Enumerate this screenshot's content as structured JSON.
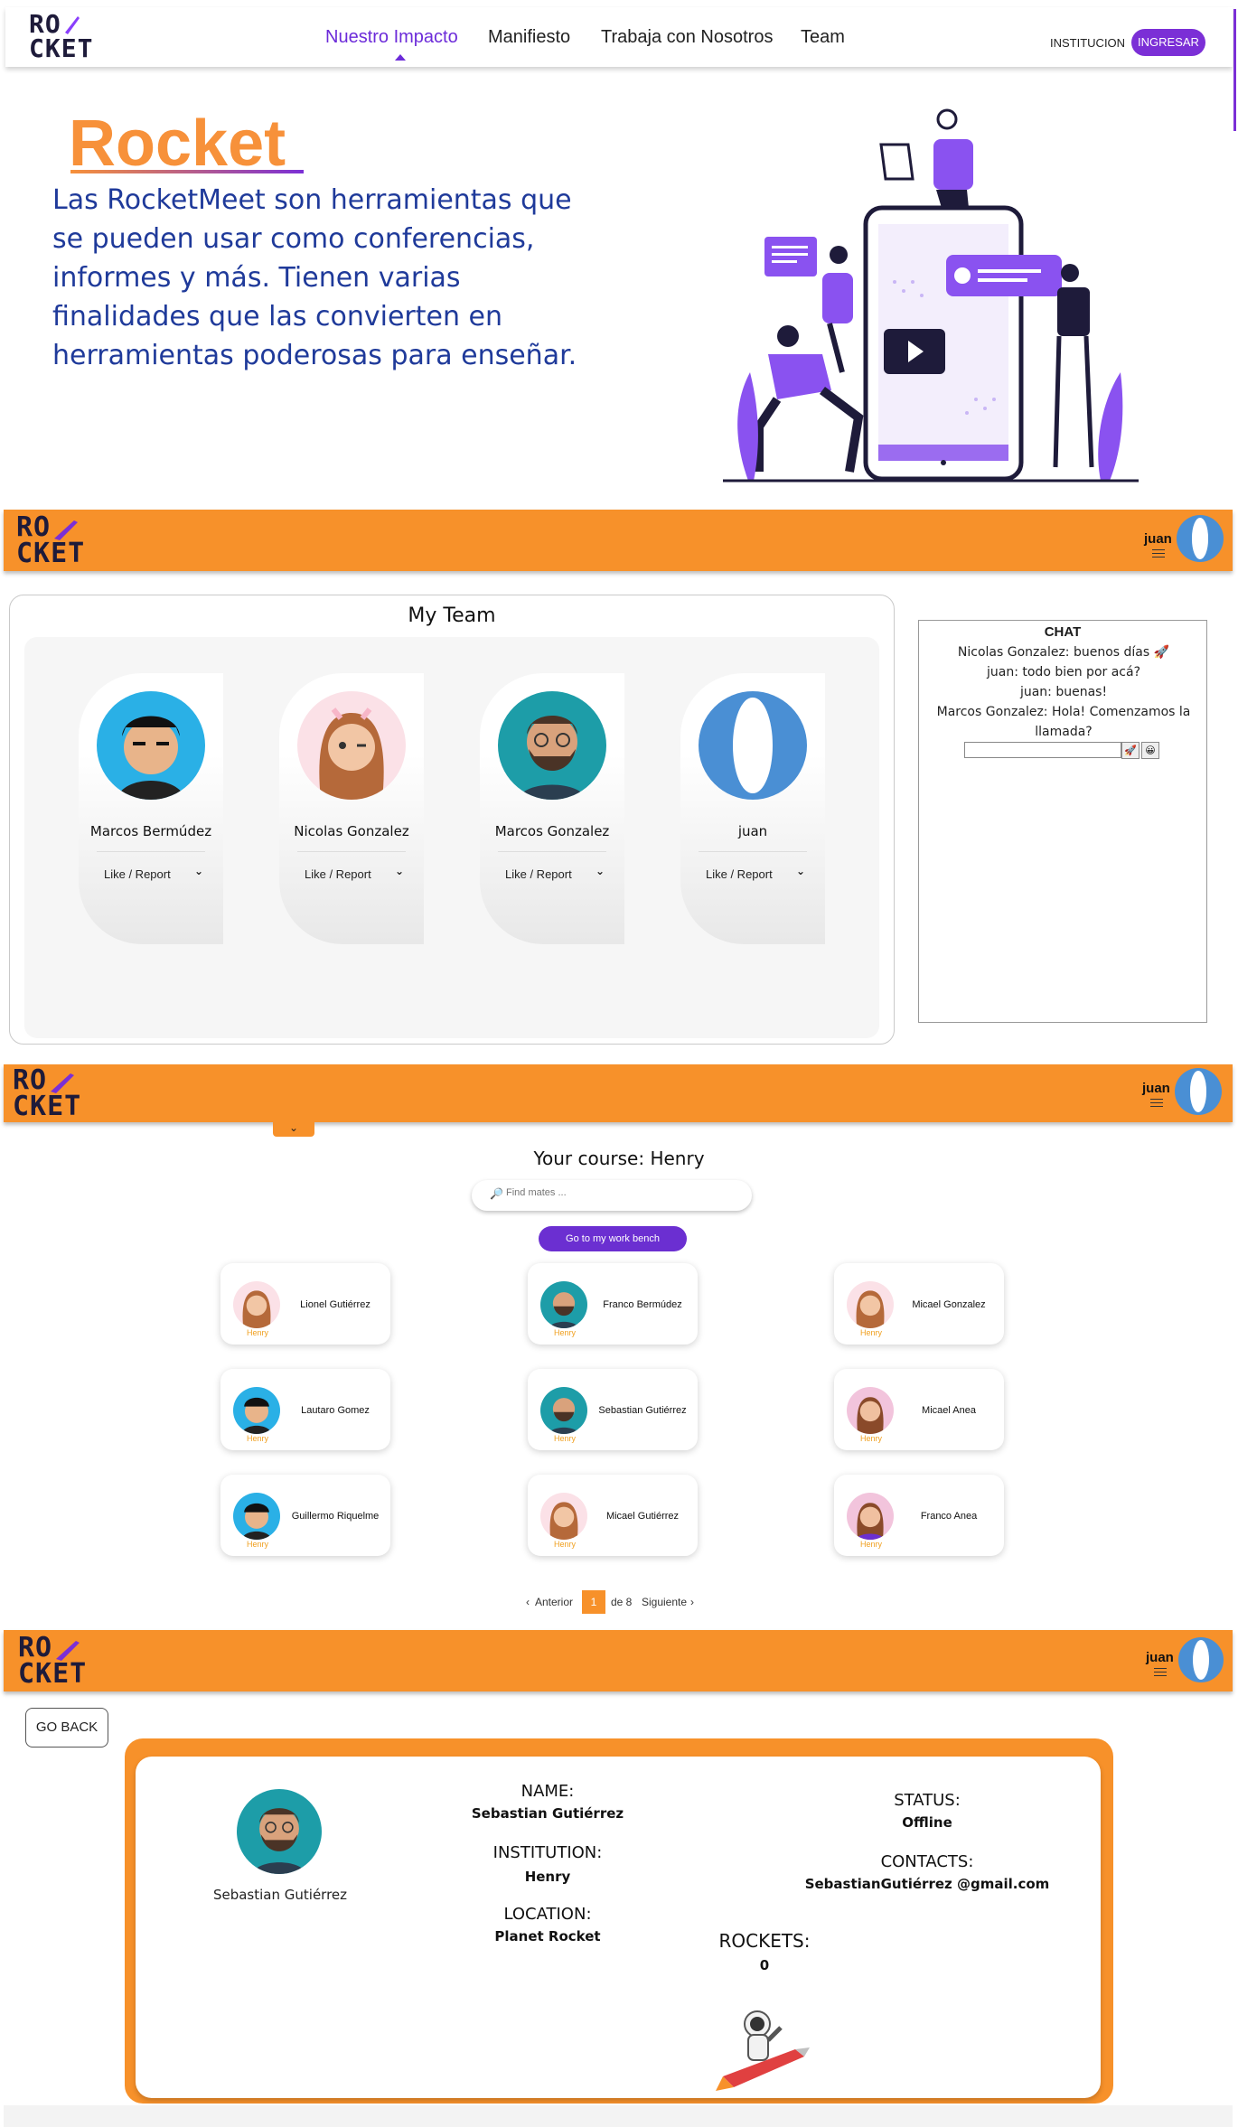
{
  "landing": {
    "logo_line1": "RO",
    "logo_line2": "CKET",
    "nav": [
      "Nuestro Impacto",
      "Manifiesto",
      "Trabaja con Nosotros",
      "Team"
    ],
    "institucion": "INSTITUCION",
    "ingresar": "INGRESAR",
    "hero_title": "Rocket",
    "hero_text": "Las RocketMeet son herramientas que se pueden usar como conferencias, informes y más. Tienen varias finalidades que las convierten en herramientas poderosas para enseñar."
  },
  "app": {
    "logo_line1": "RO",
    "logo_line2": "CKET",
    "user": "juan",
    "accent": "#f7912a",
    "purple": "#6b2fd1"
  },
  "team": {
    "title": "My Team",
    "members": [
      {
        "name": "Marcos Bermúdez",
        "action": "Like / Report"
      },
      {
        "name": "Nicolas Gonzalez",
        "action": "Like / Report"
      },
      {
        "name": "Marcos Gonzalez",
        "action": "Like / Report"
      },
      {
        "name": "juan",
        "action": "Like / Report"
      }
    ]
  },
  "chat": {
    "title": "CHAT",
    "messages": [
      "Nicolas Gonzalez: buenos días 🚀",
      "juan: todo bien por acá?",
      "juan: buenas!",
      "Marcos Gonzalez: Hola! Comenzamos la llamada?"
    ],
    "send_icon": "🚀",
    "emoji_icon": "😀"
  },
  "course": {
    "title": "Your course: Henry",
    "search_placeholder": "Find mates ...",
    "workbench": "Go to my work bench",
    "mates": [
      {
        "name": "Lionel Gutiérrez",
        "course": "Henry"
      },
      {
        "name": "Franco Bermúdez",
        "course": "Henry"
      },
      {
        "name": "Micael Gonzalez",
        "course": "Henry"
      },
      {
        "name": "Lautaro Gomez",
        "course": "Henry"
      },
      {
        "name": "Sebastian Gutiérrez",
        "course": "Henry"
      },
      {
        "name": "Micael Anea",
        "course": "Henry"
      },
      {
        "name": "Guillermo Riquelme",
        "course": "Henry"
      },
      {
        "name": "Micael Gutiérrez",
        "course": "Henry"
      },
      {
        "name": "Franco Anea",
        "course": "Henry"
      }
    ],
    "pager": {
      "prev": "Anterior",
      "current": "1",
      "of": "de 8",
      "next": "Siguiente"
    }
  },
  "profile": {
    "go_back": "GO BACK",
    "caption": "Sebastian Gutiérrez",
    "name_label": "NAME:",
    "name_value": "Sebastian Gutiérrez",
    "institution_label": "INSTITUTION:",
    "institution_value": "Henry",
    "location_label": "LOCATION:",
    "location_value": "Planet Rocket",
    "status_label": "STATUS:",
    "status_value": "Offline",
    "contacts_label": "CONTACTS:",
    "contacts_value": "SebastianGutiérrez @gmail.com",
    "rockets_label": "ROCKETS:",
    "rockets_value": "0"
  }
}
